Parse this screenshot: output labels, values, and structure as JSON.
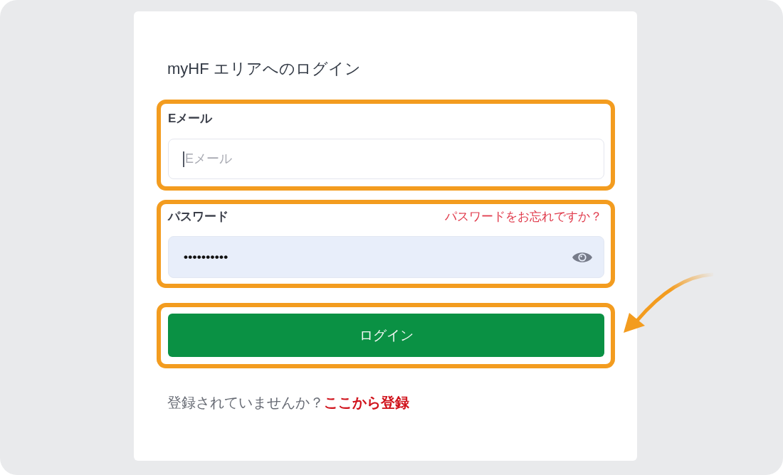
{
  "title": "myHF エリアへのログイン",
  "email": {
    "label": "Eメール",
    "placeholder": "Eメール",
    "focused": true,
    "highlighted": true
  },
  "password": {
    "label": "パスワード",
    "forgot_link": "パスワードをお忘れですか？",
    "value": "••••••••••",
    "highlighted": true
  },
  "login_button": {
    "label": "ログイン",
    "highlighted": true,
    "pointed_at": true
  },
  "register": {
    "prompt": "登録されていませんか？",
    "link": "ここから登録"
  }
}
